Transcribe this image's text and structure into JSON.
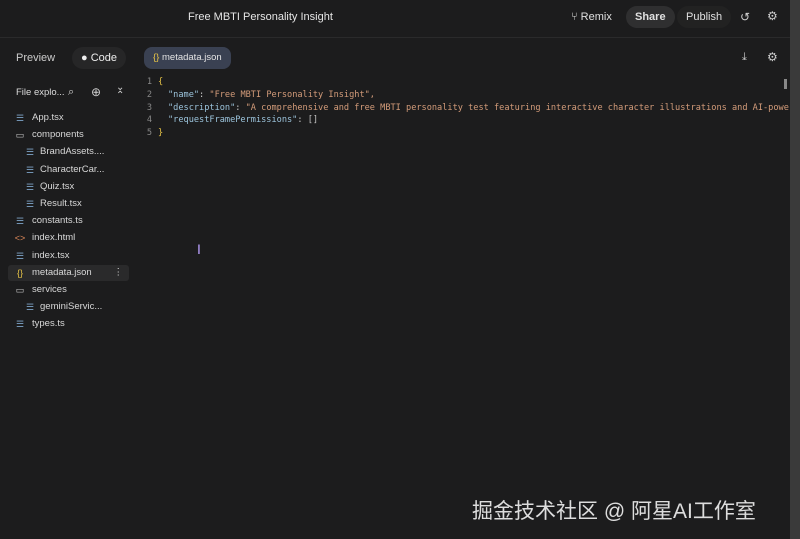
{
  "header": {
    "title": "Free MBTI Personality Insight",
    "remix": "Remix",
    "share": "Share",
    "publish": "Publish"
  },
  "tabs": {
    "preview": "Preview",
    "code": "Code",
    "open_file": "metadata.json"
  },
  "explorer": {
    "title": "File explo...",
    "items": [
      {
        "label": "App.tsx",
        "type": "file",
        "depth": 0
      },
      {
        "label": "components",
        "type": "folder",
        "depth": 0
      },
      {
        "label": "BrandAssets....",
        "type": "file",
        "depth": 1
      },
      {
        "label": "CharacterCar...",
        "type": "file",
        "depth": 1
      },
      {
        "label": "Quiz.tsx",
        "type": "file",
        "depth": 1
      },
      {
        "label": "Result.tsx",
        "type": "file",
        "depth": 1
      },
      {
        "label": "constants.ts",
        "type": "file",
        "depth": 0
      },
      {
        "label": "index.html",
        "type": "html",
        "depth": 0
      },
      {
        "label": "index.tsx",
        "type": "file",
        "depth": 0
      },
      {
        "label": "metadata.json",
        "type": "json",
        "depth": 0,
        "selected": true
      },
      {
        "label": "services",
        "type": "folder",
        "depth": 0
      },
      {
        "label": "geminiServic...",
        "type": "file",
        "depth": 1
      },
      {
        "label": "types.ts",
        "type": "file",
        "depth": 0
      }
    ]
  },
  "editor": {
    "lines": [
      {
        "n": "1",
        "open": "{"
      },
      {
        "n": "2",
        "key": "\"name\"",
        "val": "\"Free MBTI Personality Insight\","
      },
      {
        "n": "3",
        "key": "\"description\"",
        "val": "\"A comprehensive and free MBTI personality test featuring interactive character illustrations and AI-powe"
      },
      {
        "n": "4",
        "key": "\"requestFramePermissions\"",
        "val": "[]"
      },
      {
        "n": "5",
        "open": "}"
      }
    ]
  },
  "watermark": "掘金技术社区 @ 阿星AI工作室"
}
